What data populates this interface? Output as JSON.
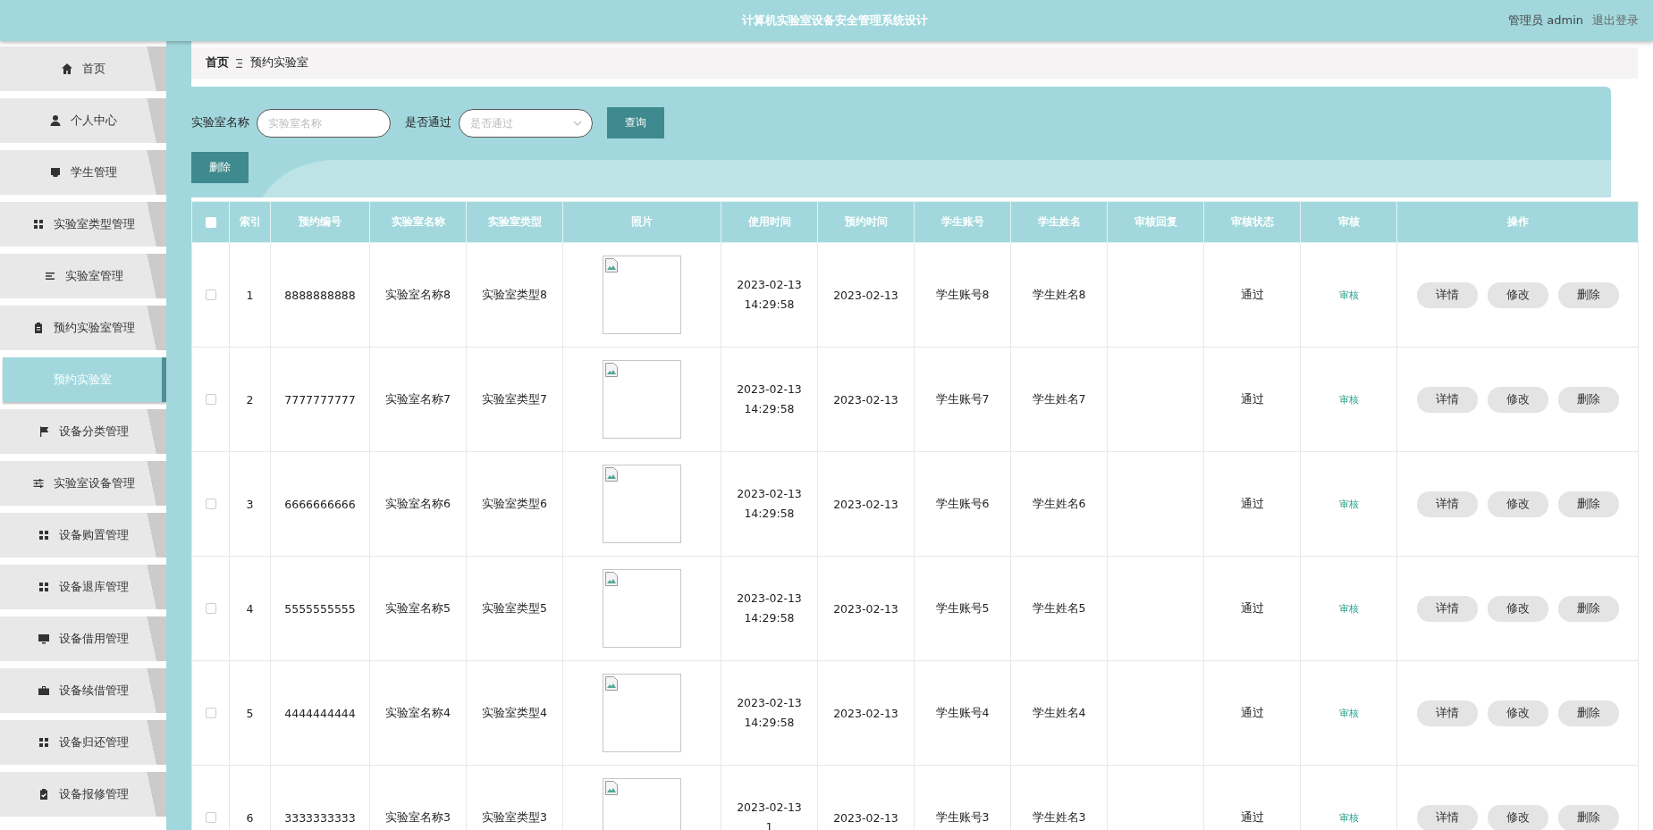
{
  "header": {
    "title": "计算机实验室设备安全管理系统设计",
    "user": "管理员 admin",
    "logout": "退出登录"
  },
  "sidebar": {
    "items": [
      {
        "label": "首页",
        "selected": false
      },
      {
        "label": "个人中心",
        "selected": false
      },
      {
        "label": "学生管理",
        "selected": false
      },
      {
        "label": "实验室类型管理",
        "selected": false
      },
      {
        "label": "实验室管理",
        "selected": false
      },
      {
        "label": "预约实验室管理",
        "selected": false
      },
      {
        "label": "预约实验室",
        "selected": true
      },
      {
        "label": "设备分类管理",
        "selected": false
      },
      {
        "label": "实验室设备管理",
        "selected": false
      },
      {
        "label": "设备购置管理",
        "selected": false
      },
      {
        "label": "设备退库管理",
        "selected": false
      },
      {
        "label": "设备借用管理",
        "selected": false
      },
      {
        "label": "设备续借管理",
        "selected": false
      },
      {
        "label": "设备归还管理",
        "selected": false
      },
      {
        "label": "设备报修管理",
        "selected": false
      }
    ]
  },
  "breadcrumb": {
    "home": "首页",
    "current": "预约实验室"
  },
  "search": {
    "fields": [
      {
        "kind": "text",
        "label": "实验室名称",
        "placeholder": "实验室名称"
      },
      {
        "kind": "select",
        "label": "是否通过",
        "placeholder": "是否通过"
      }
    ],
    "query_button": "查询",
    "delete_button": "删除"
  },
  "table": {
    "columns": [
      "索引",
      "预约编号",
      "实验室名称",
      "实验室类型",
      "照片",
      "使用时间",
      "预约时间",
      "学生账号",
      "学生姓名",
      "审核回复",
      "审核状态",
      "审核",
      "操作"
    ],
    "all_checked": false,
    "rows": [
      {
        "checked": false,
        "index": "1",
        "booking_no": "8888888888",
        "lab_name": "实验室名称8",
        "lab_type": "实验室类型8",
        "use_time": "2023-02-13 14:29:58",
        "booking_time": "2023-02-13",
        "student_account": "学生账号8",
        "student_name": "学生姓名8",
        "status": "通过",
        "review": "审核",
        "actions": [
          "详情",
          "修改",
          "删除"
        ]
      },
      {
        "checked": false,
        "index": "2",
        "booking_no": "7777777777",
        "lab_name": "实验室名称7",
        "lab_type": "实验室类型7",
        "use_time": "2023-02-13 14:29:58",
        "booking_time": "2023-02-13",
        "student_account": "学生账号7",
        "student_name": "学生姓名7",
        "status": "通过",
        "review": "审核",
        "actions": [
          "详情",
          "修改",
          "删除"
        ]
      },
      {
        "checked": false,
        "index": "3",
        "booking_no": "6666666666",
        "lab_name": "实验室名称6",
        "lab_type": "实验室类型6",
        "use_time": "2023-02-13 14:29:58",
        "booking_time": "2023-02-13",
        "student_account": "学生账号6",
        "student_name": "学生姓名6",
        "status": "通过",
        "review": "审核",
        "actions": [
          "详情",
          "修改",
          "删除"
        ]
      },
      {
        "checked": false,
        "index": "4",
        "booking_no": "5555555555",
        "lab_name": "实验室名称5",
        "lab_type": "实验室类型5",
        "use_time": "2023-02-13 14:29:58",
        "booking_time": "2023-02-13",
        "student_account": "学生账号5",
        "student_name": "学生姓名5",
        "status": "通过",
        "review": "审核",
        "actions": [
          "详情",
          "修改",
          "删除"
        ]
      },
      {
        "checked": false,
        "index": "5",
        "booking_no": "4444444444",
        "lab_name": "实验室名称4",
        "lab_type": "实验室类型4",
        "use_time": "2023-02-13 14:29:58",
        "booking_time": "2023-02-13",
        "student_account": "学生账号4",
        "student_name": "学生姓名4",
        "status": "通过",
        "review": "审核",
        "actions": [
          "详情",
          "修改",
          "删除"
        ]
      },
      {
        "checked": false,
        "index": "6",
        "booking_no": "3333333333",
        "lab_name": "实验室名称3",
        "lab_type": "实验室类型3",
        "use_time": "2023-02-13 1",
        "booking_time": "2023-02-13",
        "student_account": "学生账号3",
        "student_name": "学生姓名3",
        "status": "通过",
        "review": "审核",
        "actions": [
          "详情",
          "修改",
          "删除"
        ]
      }
    ]
  }
}
